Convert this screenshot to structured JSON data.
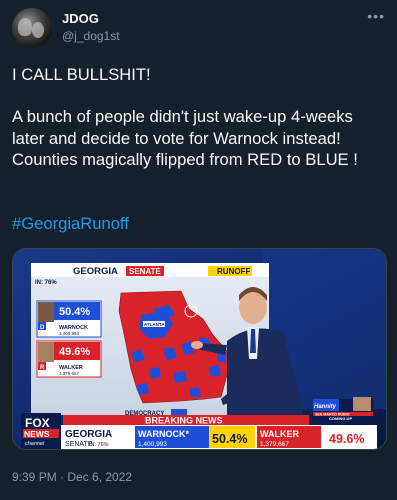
{
  "user": {
    "name": "JDOG",
    "handle": "@j_dog1st"
  },
  "tweet": {
    "line1": "I CALL BULLSHIT!",
    "line2": "A bunch of people didn't just wake-up 4-weeks later and decide to vote for Warnock instead!  Counties magically flipped from RED to BLUE !",
    "hashtag": "#GeorgiaRunoff",
    "timestamp": "9:39 PM · Dec 6, 2022"
  },
  "broadcast": {
    "board_title": "GEORGIA",
    "board_race": "SENATE",
    "board_runoff": "RUNOFF",
    "board_in": "IN: 76%",
    "warnock_pct": "50.4%",
    "warnock_name": "WARNOCK",
    "warnock_votes": "1,400,993",
    "walker_pct": "49.6%",
    "walker_name": "WALKER",
    "walker_votes": "1,379,667",
    "atlanta_label": "ATLANTA",
    "breaking": "BREAKING NEWS",
    "channel_fox": "FOX",
    "channel_news": "NEWS",
    "channel_sub": "channel",
    "lower_state": "GEORGIA",
    "lower_race": "SENATE",
    "lower_in": "IN: 76%",
    "lower_warnock": "WARNOCK*",
    "lower_warnock_votes": "1,400,993",
    "lower_warnock_pct": "50.4%",
    "lower_walker": "WALKER",
    "lower_walker_votes": "1,379,667",
    "lower_walker_pct": "49.6%",
    "hannity": "Hannity",
    "promo_line1": "SEN MARCO RUBIO",
    "promo_line2": "COMING UP",
    "democracy": "DEMOCRACY",
    "colors": {
      "blue": "#1e4fd6",
      "red": "#d8232a",
      "yellow": "#ffd200",
      "navy": "#0a1a4a"
    }
  }
}
